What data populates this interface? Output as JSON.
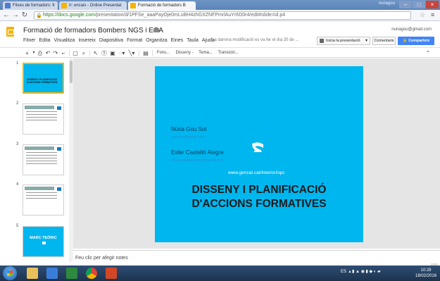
{
  "browser": {
    "tabs": [
      {
        "label": "Fitxes de formadors: fr"
      },
      {
        "label": "Ir: encaix - Online Presentat"
      },
      {
        "label": "Formació de formadors B"
      }
    ],
    "user": "nuriagou",
    "url_host": "https://docs.google.com",
    "url_path": "/presentation/d/1PFSe_aaaPayOje0mLuBH4zhGXZNFPmrlAuYr6D0r4/edit#slide=id.p4"
  },
  "doc": {
    "title": "Formació de formadors Bombers NGS i ECA",
    "menu": [
      "Fitxer",
      "Edita",
      "Visualitza",
      "Insereix",
      "Diapositiva",
      "Format",
      "Organitza",
      "Eines",
      "Taula",
      "Ajuda"
    ],
    "last_edit": "La darrera modificació es va fer el dia 20 de ...",
    "user_email": "nuriagou@gmail.com",
    "present_label": "Inicia la presentació",
    "comments_label": "Comentaris",
    "share_label": "Comparteix"
  },
  "toolbar": {
    "font_label": "Fons...",
    "design_label": "Disseny -",
    "theme_label": "Tema...",
    "transition_label": "Transició..."
  },
  "filmstrip": {
    "slides": [
      {
        "num": "1",
        "title": "DISSENY I PLANIFICACIÓ D'ACCIONS FORMATIVES"
      },
      {
        "num": "2"
      },
      {
        "num": "3"
      },
      {
        "num": "4"
      },
      {
        "num": "5",
        "title": "MARC TEÒRIC"
      }
    ]
  },
  "slide": {
    "name1": "Núria Gou Sol",
    "email1": "nuriaxou@gmail.com",
    "name2": "Ester Castelló Alegre",
    "email2": "ester.castelloalegre@hotmail.com",
    "url": "www.gencat.cat/interior/ispc",
    "title_line1": "DISSENY I PLANIFICACIÓ",
    "title_line2": "D'ACCIONS FORMATIVES"
  },
  "notes_placeholder": "Feu clic per afegir notes",
  "taskbar": {
    "lang": "ES",
    "time": "10:28",
    "date": "18/02/2016"
  }
}
